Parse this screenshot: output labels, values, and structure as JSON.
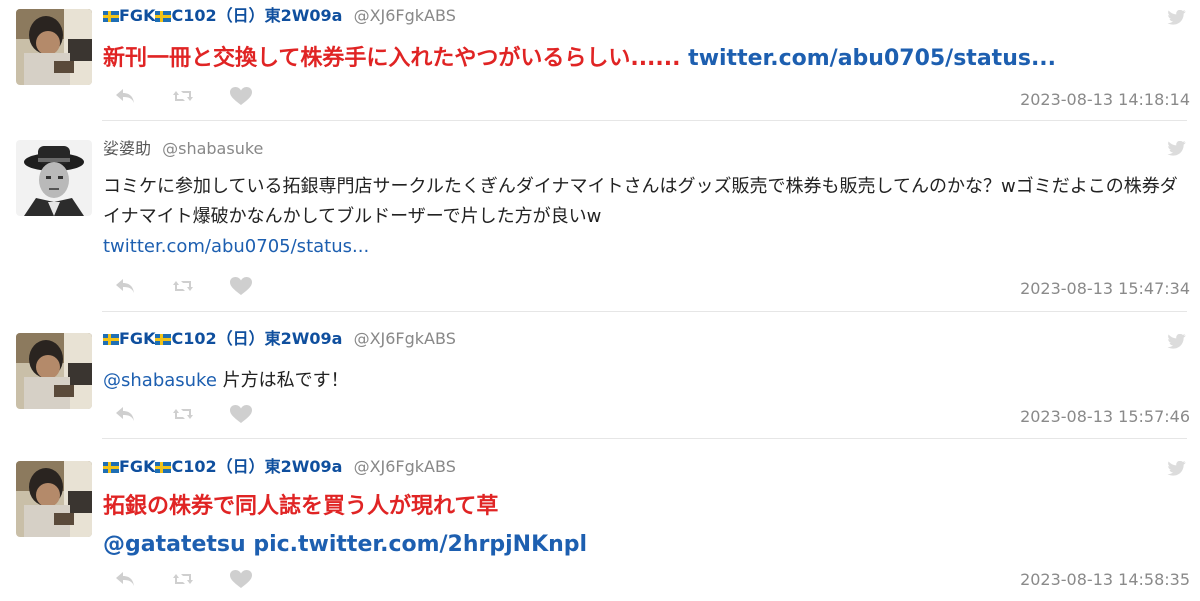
{
  "tweets": [
    {
      "display_name": "FGK",
      "display_name_rest": "C102（日）東2W09a",
      "screen_name": "@XJ6FgkABS",
      "body_text": "新刊一冊と交換して株券手に入れたやつがいるらしい......",
      "body_link": "twitter.com/abu0705/status...",
      "timestamp": "2023-08-13 14:18:14"
    },
    {
      "display_name": "娑婆助",
      "screen_name": "@shabasuke",
      "body_text": "コミケに参加している拓銀専門店サークルたくぎんダイナマイトさんはグッズ販売で株券も販売してんのかな？wゴミだよこの株券ダイナマイト爆破かなんかしてブルドーザーで片した方が良いw",
      "body_link": "twitter.com/abu0705/status...",
      "timestamp": "2023-08-13 15:47:34"
    },
    {
      "display_name": "FGK",
      "display_name_rest": "C102（日）東2W09a",
      "screen_name": "@XJ6FgkABS",
      "mention": "@shabasuke",
      "body_text": " 片方は私です！",
      "timestamp": "2023-08-13 15:57:46"
    },
    {
      "display_name": "FGK",
      "display_name_rest": "C102（日）東2W09a",
      "screen_name": "@XJ6FgkABS",
      "body_text": "拓銀の株券で同人誌を買う人が現れて草",
      "mention": "@gatatetsu",
      "body_link": "pic.twitter.com/2hrpjNKnpl",
      "timestamp": "2023-08-13 14:58:35"
    }
  ],
  "icons": {
    "reply": "reply-icon",
    "retweet": "retweet-icon",
    "like": "heart-icon",
    "bird": "twitter-bird-icon"
  },
  "colors": {
    "name_blue": "#0f4f9e",
    "link_blue": "#1d5fb0",
    "highlight_red": "#e02424",
    "timestamp_gray": "#8a8a8a",
    "icon_gray": "#cfcfcf"
  }
}
